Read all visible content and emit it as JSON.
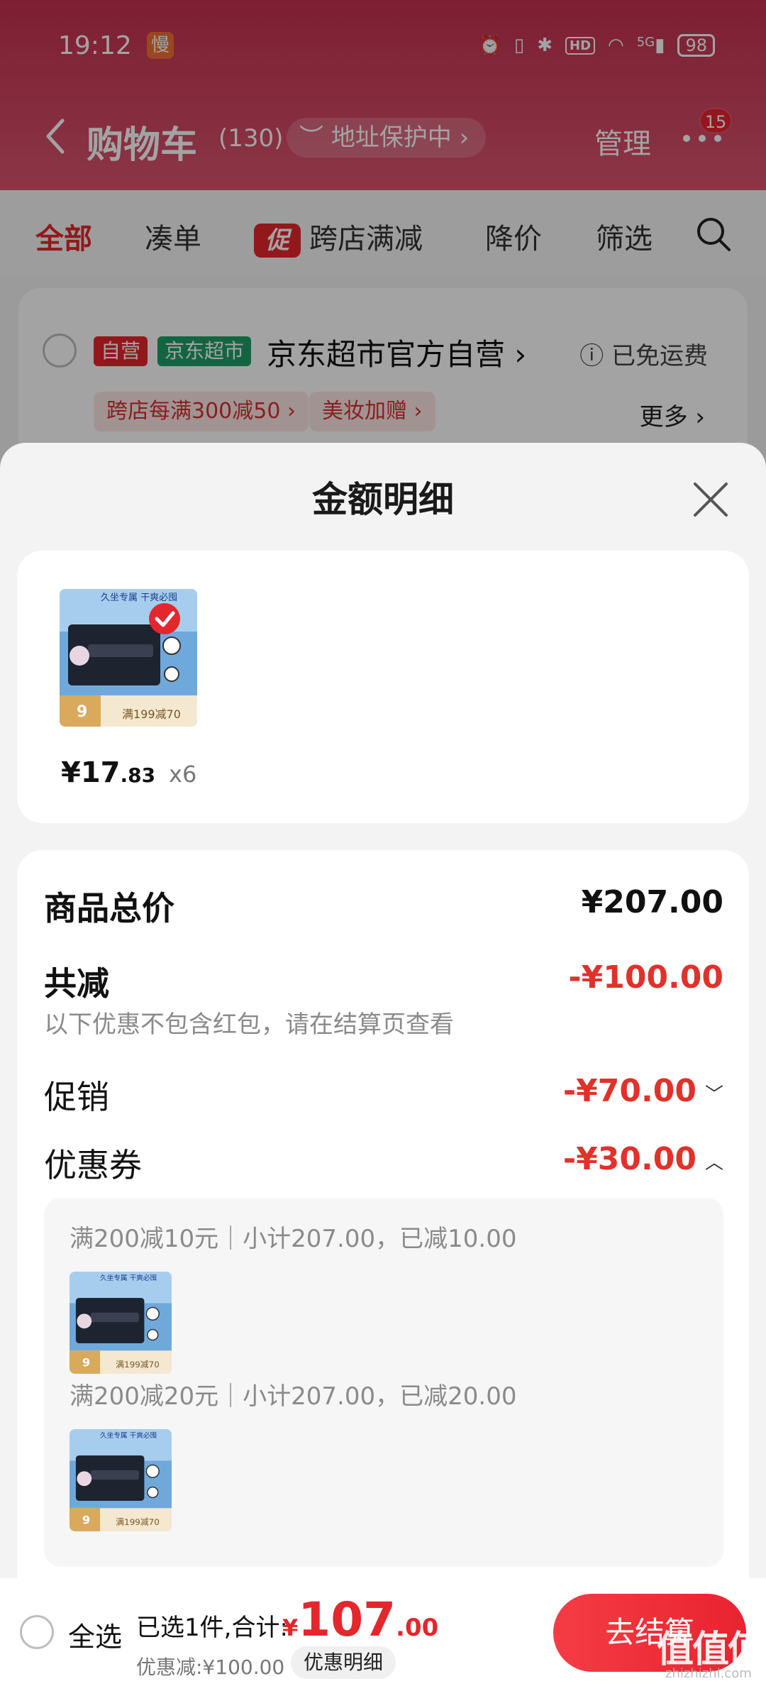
{
  "status_bar": {
    "time": "19:12",
    "app_icon": "慢",
    "network": "5G",
    "hd": "HD",
    "battery": "98"
  },
  "nav": {
    "title": "购物车",
    "count": "(130)",
    "address_pill": "地址保护中",
    "manage": "管理",
    "badge": "15"
  },
  "tabs": [
    {
      "label": "全部",
      "active": true
    },
    {
      "label": "凑单",
      "active": false
    },
    {
      "tag": "促",
      "label": "跨店满减",
      "active": false
    },
    {
      "label": "降价",
      "active": false
    },
    {
      "label": "筛选",
      "active": false
    }
  ],
  "store": {
    "badge_self": "自营",
    "badge_market": "京东超市",
    "name": "京东超市官方自营",
    "shipping": "已免运费",
    "promos": [
      "跨店每满300减50",
      "美妆加赠"
    ],
    "more": "更多"
  },
  "sheet": {
    "title": "金额明细",
    "item": {
      "price_int": "¥17",
      "price_dec": ".83",
      "qty": "x6"
    },
    "total_label": "商品总价",
    "total_value": "¥207.00",
    "discount_label": "共减",
    "discount_value": "-¥100.00",
    "hint": "以下优惠不包含红包，请在结算页查看",
    "promo_label": "促销",
    "promo_value": "-¥70.00",
    "coupon_label": "优惠券",
    "coupon_value": "-¥30.00",
    "coupons": [
      "满200减10元｜小计207.00，已减10.00",
      "满200减20元｜小计207.00，已减20.00"
    ]
  },
  "product_image_text": {
    "top": "久坐专属  干爽必囤",
    "band": "满199减70",
    "count": "9"
  },
  "bottom": {
    "select_all": "全选",
    "selected": "已选1件,合计:",
    "currency": "¥",
    "total_int": "107",
    "total_dec": ".00",
    "saving": "优惠减:¥100.00",
    "detail_button": "优惠明细",
    "checkout": "去结算"
  },
  "watermark": {
    "main": "值值值",
    "sub": "zhizhizhi.com"
  },
  "colors": {
    "accent": "#e4262d",
    "header": "#c4304f",
    "discount": "#e0322b"
  }
}
